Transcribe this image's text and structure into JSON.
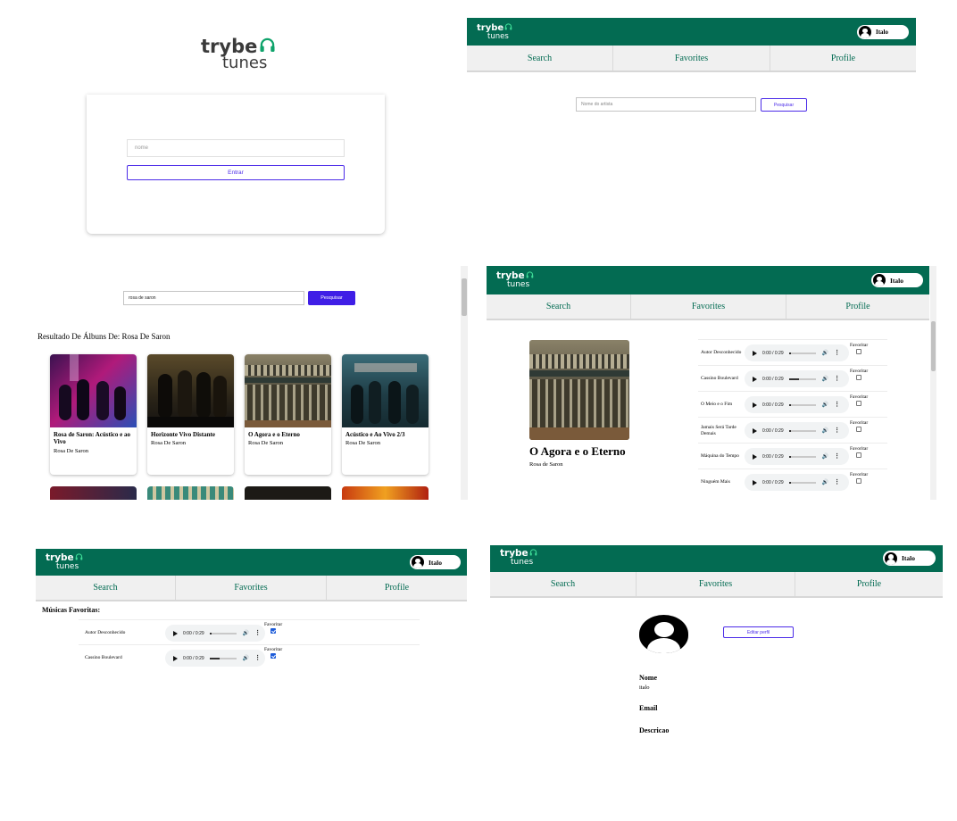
{
  "brand": {
    "logo_line1": "trybe",
    "logo_line2": "tunes",
    "colors": {
      "header_green": "#036b52",
      "accent_purple": "#3f1ee6",
      "nav_bg": "#f0f0f0"
    }
  },
  "login": {
    "name_placeholder": "nome",
    "enter_button": "Entrar"
  },
  "header": {
    "user_name": "Italo",
    "nav": [
      "Search",
      "Favorites",
      "Profile"
    ]
  },
  "search_empty": {
    "artist_placeholder": "Nome do artista",
    "search_button": "Pesquisar"
  },
  "search_results": {
    "input_value": "rosa de saron",
    "search_button": "Pesquisar",
    "result_heading": "Resultado De Álbuns De: Rosa De Saron",
    "albums": [
      {
        "title": "Rosa de Saron: Acústico e ao Vivo",
        "artist": "Rosa De Saron"
      },
      {
        "title": "Horizonte Vivo Distante",
        "artist": "Rosa De Saron"
      },
      {
        "title": "O Agora e o Eterno",
        "artist": "Rosa De Saron"
      },
      {
        "title": "Acústico e Ao Vivo 2/3",
        "artist": "Rosa De Saron"
      }
    ]
  },
  "album": {
    "title": "O Agora e o Eterno",
    "artist": "Rosa de Saron",
    "tracks": [
      {
        "name": "Autor Desconhecido",
        "time": "0:00 / 0:29",
        "fav_label": "Favoritar",
        "progress": 0.05
      },
      {
        "name": "Cassino Boulevard",
        "time": "0:00 / 0:29",
        "fav_label": "Favoritar",
        "progress": 0.35
      },
      {
        "name": "O Meio e o Fim",
        "time": "0:00 / 0:29",
        "fav_label": "Favoritar",
        "progress": 0.05
      },
      {
        "name": "Jamais Será Tarde Demais",
        "time": "0:00 / 0:29",
        "fav_label": "Favoritar",
        "progress": 0.05
      },
      {
        "name": "Máquina do Tempo",
        "time": "0:00 / 0:29",
        "fav_label": "Favoritar",
        "progress": 0.05
      },
      {
        "name": "Ninguém Mais",
        "time": "0:00 / 0:29",
        "fav_label": "Favoritar",
        "progress": 0.05
      }
    ]
  },
  "favorites": {
    "heading": "Músicas Favoritas:",
    "tracks": [
      {
        "name": "Autor Desconhecido",
        "time": "0:00 / 0:29",
        "fav_label": "Favoritar",
        "checked": true,
        "progress": 0.05
      },
      {
        "name": "Cassino Boulevard",
        "time": "0:00 / 0:29",
        "fav_label": "Favoritar",
        "checked": true,
        "progress": 0.35
      }
    ]
  },
  "profile": {
    "edit_button": "Editar perfil",
    "name_label": "Nome",
    "name_value": "italo",
    "email_label": "Email",
    "description_label": "Descricao"
  }
}
